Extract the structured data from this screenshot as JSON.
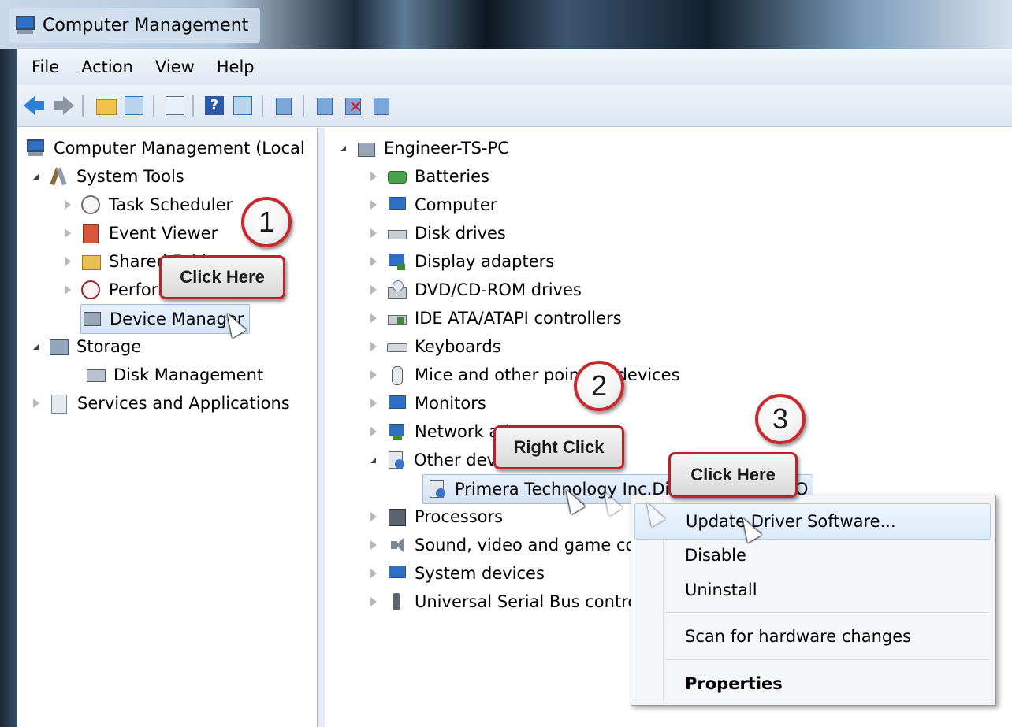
{
  "window": {
    "title": "Computer Management"
  },
  "menubar": {
    "items": [
      "File",
      "Action",
      "View",
      "Help"
    ]
  },
  "left_tree": {
    "root": "Computer Management (Local",
    "system_tools": "System Tools",
    "task_scheduler": "Task Scheduler",
    "event_viewer": "Event Viewer",
    "shared_folders": "Shared Folders",
    "performance": "Performance",
    "device_manager": "Device Manager",
    "storage": "Storage",
    "disk_management": "Disk Management",
    "services_apps": "Services and Applications"
  },
  "device_tree": {
    "root": "Engineer-TS-PC",
    "items": [
      "Batteries",
      "Computer",
      "Disk drives",
      "Display adapters",
      "DVD/CD-ROM drives",
      "IDE ATA/ATAPI controllers",
      "Keyboards",
      "Mice and other pointing devices",
      "Monitors",
      "Network adapters",
      "Other devices"
    ],
    "child_device": "Primera Technology Inc.Disc Publisher PRO",
    "items_after": [
      "Processors",
      "Sound, video and game controllers",
      "System devices",
      "Universal Serial Bus controllers"
    ]
  },
  "context_menu": {
    "update": "Update Driver Software...",
    "disable": "Disable",
    "uninstall": "Uninstall",
    "scan": "Scan for hardware changes",
    "properties": "Properties"
  },
  "annotations": {
    "step1": "1",
    "step2": "2",
    "step3": "3",
    "callout1": "Click Here",
    "callout2": "Right Click",
    "callout3": "Click Here"
  },
  "colors": {
    "accent_red": "#c9282f",
    "selection": "#d4e3f5",
    "menu_highlight": "#dcebfc"
  }
}
